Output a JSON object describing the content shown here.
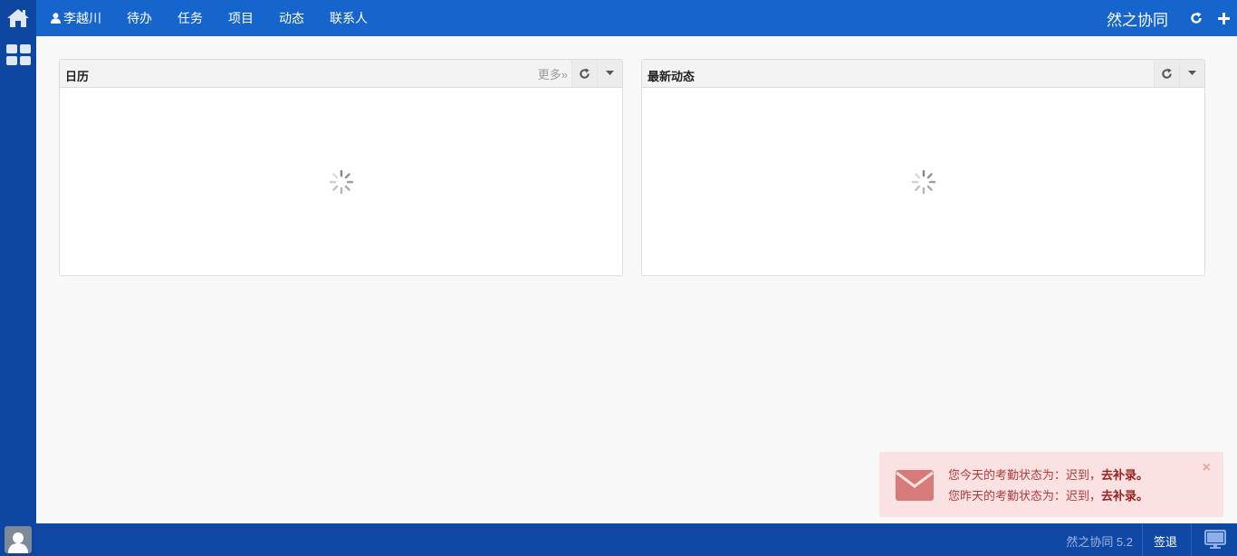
{
  "nav": {
    "user_name": "李越川",
    "items": [
      "待办",
      "任务",
      "项目",
      "动态",
      "联系人"
    ]
  },
  "brand": "然之协同",
  "panels": {
    "calendar": {
      "title": "日历",
      "more": "更多»"
    },
    "activity": {
      "title": "最新动态"
    }
  },
  "alert": {
    "line1_prefix": "您今天的考勤状态为：迟到，",
    "line1_link": "去补录。",
    "line2_prefix": "您昨天的考勤状态为：迟到，",
    "line2_link": "去补录。",
    "close": "×"
  },
  "footer": {
    "version": "然之协同 5.2",
    "signout": "签退"
  },
  "colors": {
    "rail": "#0d47a1",
    "topbar": "#1565cd",
    "footer": "#1048a6",
    "alert_bg": "#fbe2e2",
    "alert_text": "#b33a3a"
  }
}
